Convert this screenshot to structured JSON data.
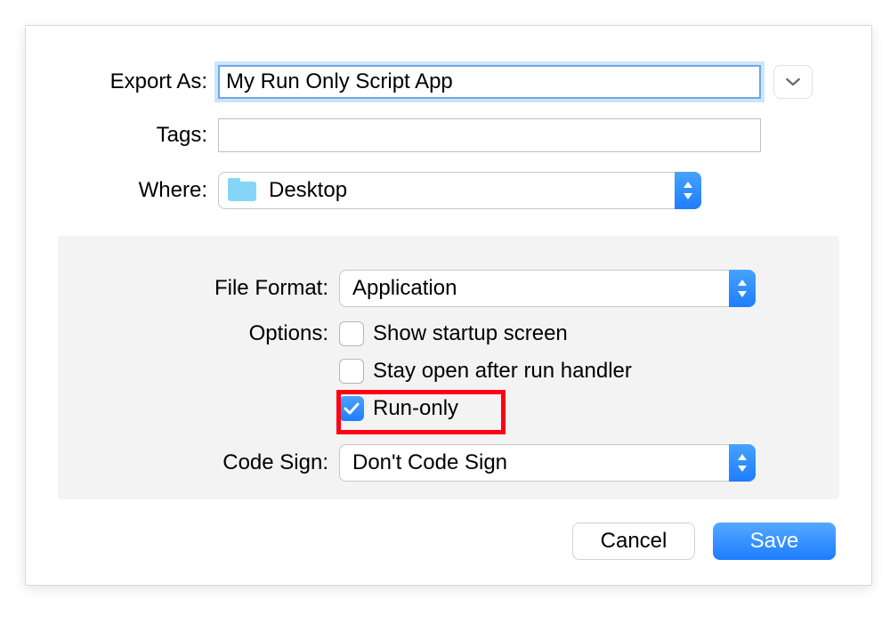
{
  "exportAs": {
    "label": "Export As:",
    "value": "My Run Only Script App"
  },
  "tags": {
    "label": "Tags:",
    "value": ""
  },
  "where": {
    "label": "Where:",
    "value": "Desktop"
  },
  "panel": {
    "format": {
      "label": "File Format:",
      "value": "Application"
    },
    "options": {
      "label": "Options:",
      "items": [
        {
          "id": "show-startup",
          "label": "Show startup screen",
          "checked": false
        },
        {
          "id": "stay-open",
          "label": "Stay open after run handler",
          "checked": false
        },
        {
          "id": "run-only",
          "label": "Run-only",
          "checked": true
        }
      ]
    },
    "codesign": {
      "label": "Code Sign:",
      "value": "Don't Code Sign"
    }
  },
  "buttons": {
    "cancel": "Cancel",
    "save": "Save"
  }
}
